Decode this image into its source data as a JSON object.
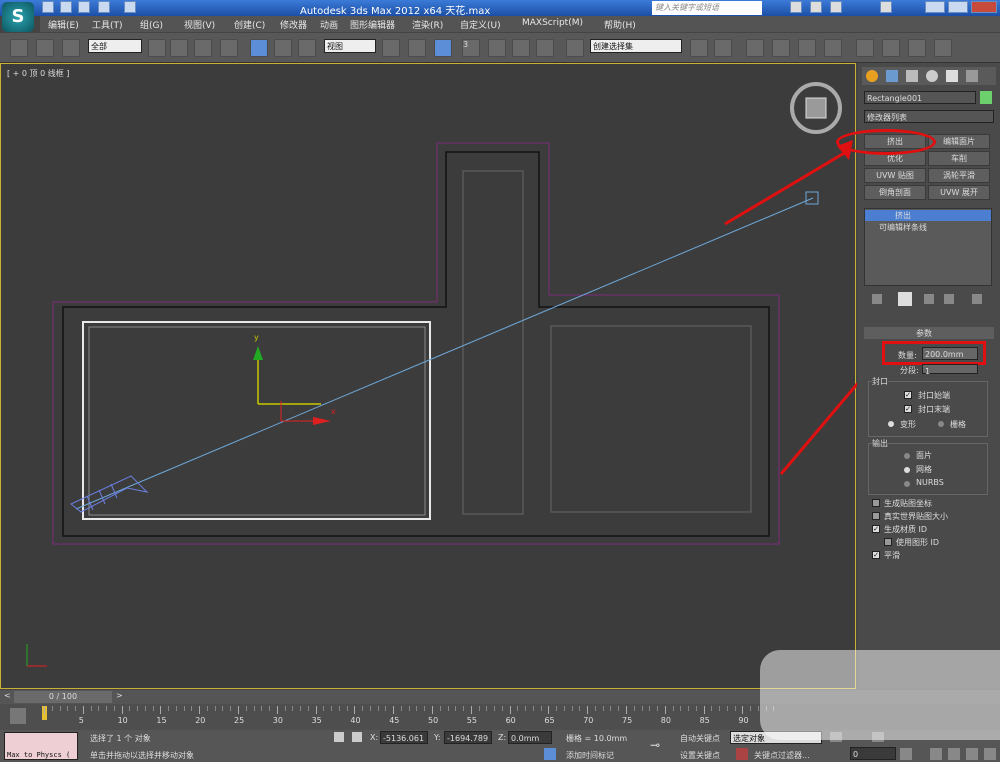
{
  "app": {
    "title": "Autodesk 3ds Max  2012 x64     天花.max",
    "search_placeholder": "键入关键字或短语",
    "logo": "S"
  },
  "menu": [
    "编辑(E)",
    "工具(T)",
    "组(G)",
    "视图(V)",
    "创建(C)",
    "修改器",
    "动画",
    "图形编辑器",
    "渲染(R)",
    "自定义(U)",
    "MAXScript(M)",
    "帮助(H)"
  ],
  "toolbar": {
    "select_filter": "全部",
    "ref_coord": "视图",
    "named_selection": "创建选择集",
    "snap_num": "3"
  },
  "viewport": {
    "label": "[ + 0 顶 0 线框 ]",
    "axis_y": "y",
    "axis_x": "x"
  },
  "panel": {
    "object_name": "Rectangle001",
    "modifier_list": "修改器列表",
    "buttons": [
      "挤出",
      "编辑面片",
      "优化",
      "车削",
      "UVW 贴图",
      "涡轮平滑",
      "倒角剖面",
      "UVW 展开"
    ],
    "stack": [
      "挤出",
      "可编辑样条线"
    ],
    "rollout": "参数",
    "amount_label": "数量:",
    "amount_value": "200.0mm",
    "segments_label": "分段:",
    "segments_value": "1",
    "cap_group": "封口",
    "cap_start": "封口始端",
    "cap_end": "封口末端",
    "morph": "变形",
    "grid": "栅格",
    "output_group": "输出",
    "out_patch": "面片",
    "out_mesh": "网格",
    "out_nurbs": "NURBS",
    "gen_mapping": "生成贴图坐标",
    "real_world": "真实世界贴图大小",
    "gen_matid": "生成材质 ID",
    "use_shape_id": "使用图形 ID",
    "smooth": "平滑"
  },
  "timeline": {
    "frame": "0 / 100",
    "ticks": [
      "0",
      "5",
      "10",
      "15",
      "20",
      "25",
      "30",
      "35",
      "40",
      "45",
      "50",
      "55",
      "60",
      "65",
      "70",
      "75",
      "80",
      "85",
      "90"
    ]
  },
  "status": {
    "maxscript": "Max to Physcs (",
    "selected": "选择了 1 个 对象",
    "hint": "单击并拖动以选择并移动对象",
    "x_label": "X:",
    "x_value": "-5136.061",
    "y_label": "Y:",
    "y_value": "-1694.789",
    "z_label": "Z:",
    "z_value": "0.0mm",
    "grid": "栅格 = 10.0mm",
    "add_tag": "添加时间标记",
    "autokey": "自动关键点",
    "setkey": "设置关键点",
    "sel_obj": "选定对象",
    "key_filter": "关键点过滤器...",
    "frame_field": "0"
  }
}
